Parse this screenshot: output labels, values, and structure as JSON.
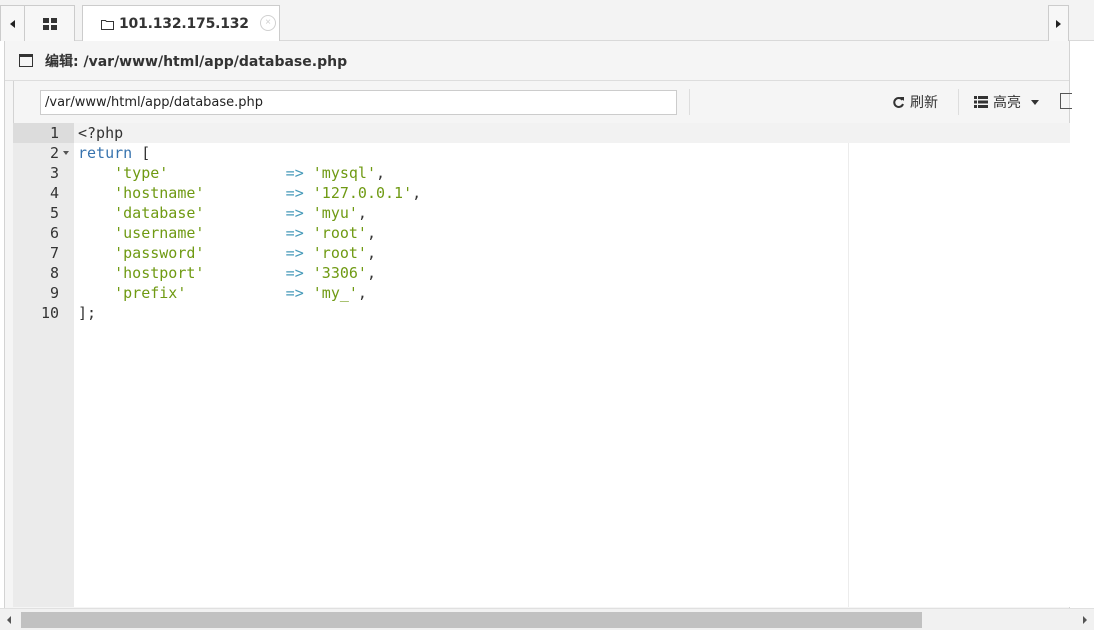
{
  "tabs": {
    "active_title": "101.132.175.132",
    "close_glyph": "×",
    "home_icon": "grid-icon",
    "tab_icon": "folder-icon"
  },
  "panel": {
    "title": "编辑: /var/www/html/app/database.php",
    "icon": "window-icon"
  },
  "toolbar": {
    "path_value": "/var/www/html/app/database.php",
    "refresh_label": "刷新",
    "refresh_icon": "refresh-icon",
    "highlight_label": "高亮",
    "highlight_icon": "list-icon"
  },
  "editor": {
    "active_line": 1,
    "fold_line": 2,
    "lines": [
      {
        "no": "1",
        "text": "<?php"
      },
      {
        "no": "2",
        "text": "return ["
      },
      {
        "no": "3",
        "key": "'type'",
        "arrow": "=>",
        "value": "'mysql'"
      },
      {
        "no": "4",
        "key": "'hostname'",
        "arrow": "=>",
        "value": "'127.0.0.1'"
      },
      {
        "no": "5",
        "key": "'database'",
        "arrow": "=>",
        "value": "'myu'"
      },
      {
        "no": "6",
        "key": "'username'",
        "arrow": "=>",
        "value": "'root'"
      },
      {
        "no": "7",
        "key": "'password'",
        "arrow": "=>",
        "value": "'root'"
      },
      {
        "no": "8",
        "key": "'hostport'",
        "arrow": "=>",
        "value": "'3306'"
      },
      {
        "no": "9",
        "key": "'prefix'",
        "arrow": "=>",
        "value": "'my_'"
      },
      {
        "no": "10",
        "text": "];"
      }
    ]
  },
  "colors": {
    "keyword": "#3773ae",
    "string": "#6f9a13",
    "operator": "#479ab9"
  }
}
